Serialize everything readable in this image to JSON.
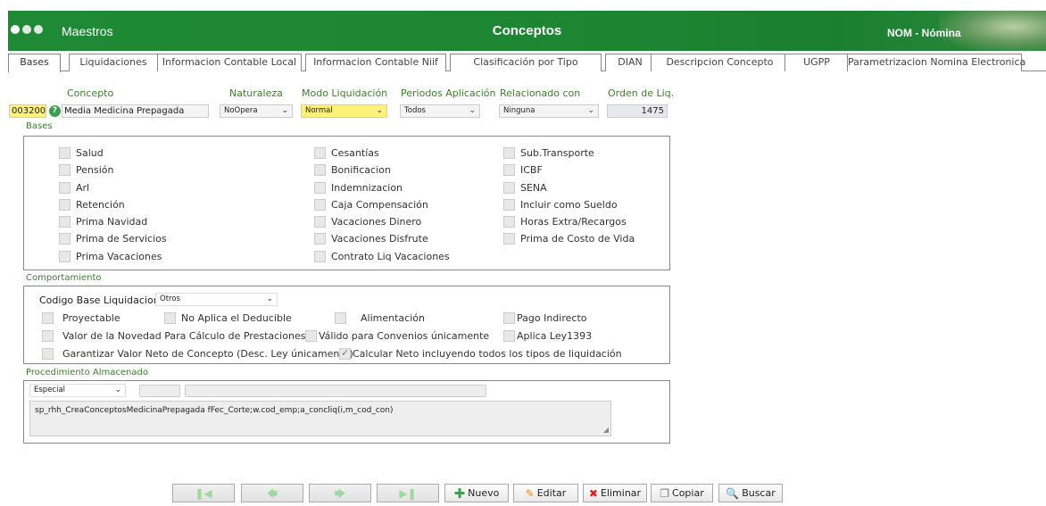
{
  "header": {
    "app_title": "Maestros",
    "page_title": "Conceptos",
    "module": "NOM - Nómina"
  },
  "tabs": [
    {
      "label": "Bases"
    },
    {
      "label": "Liquidaciones"
    },
    {
      "label": "Informacion Contable Local"
    },
    {
      "label": "Informacion Contable Niif"
    },
    {
      "label": "Clasificación por Tipo"
    },
    {
      "label": "DIAN"
    },
    {
      "label": "Descripcion Concepto"
    },
    {
      "label": "UGPP"
    },
    {
      "label": "Parametrizacion Nomina Electronica"
    }
  ],
  "form": {
    "concepto_label": "Concepto",
    "naturaleza_label": "Naturaleza",
    "modo_label": "Modo Liquidación",
    "periodos_label": "Periodos Aplicación",
    "relacionado_label": "Relacionado con",
    "orden_label": "Orden de Liq.",
    "concepto_code": "003200",
    "concepto_name": "Media Medicina Prepagada",
    "naturaleza_value": "NoOpera",
    "modo_value": "Normal",
    "periodos_value": "Todos",
    "relacionado_value": "Ninguna",
    "orden_value": "1475"
  },
  "bases": {
    "title": "Bases",
    "col1": [
      "Salud",
      "Pensión",
      "Arl",
      "Retención",
      "Prima Navidad",
      "Prima de Servicios",
      "Prima Vacaciones"
    ],
    "col2": [
      "Cesantías",
      "Bonificacion",
      "Indemnizacion",
      "Caja Compensación",
      "Vacaciones Dinero",
      "Vacaciones Disfrute",
      "Contrato Liq Vacaciones"
    ],
    "col3": [
      "Sub.Transporte",
      "ICBF",
      "SENA",
      "Incluir como Sueldo",
      "Horas Extra/Recargos",
      "Prima de Costo de Vida"
    ]
  },
  "comportamiento": {
    "title": "Comportamiento",
    "codigo_label": "Codigo Base Liquidacion",
    "codigo_value": "Otros",
    "proyectable": "Proyectable",
    "no_aplica": "No Aplica el Deducible",
    "alimentacion": "Alimentación",
    "pago_indirecto": "Pago Indirecto",
    "valor_novedad": "Valor de la Novedad Para Cálculo de Prestaciones",
    "valido_convenios": "Válido para Convenios únicamente",
    "aplica_ley": "Aplica Ley1393",
    "garantizar": "Garantizar Valor Neto de Concepto (Desc. Ley únicamente)",
    "calcular_neto": "Calcular Neto incluyendo todos los tipos de liquidación",
    "calcular_neto_checked": true
  },
  "procedimiento": {
    "title": "Procedimiento Almacenado",
    "tipo_value": "Especial",
    "text": "sp_rhh_CreaConceptosMedicinaPrepagada fFec_Corte;w.cod_emp;a_concliq(i,m_cod_con)"
  },
  "toolbar": {
    "nuevo": "Nuevo",
    "editar": "Editar",
    "eliminar": "Eliminar",
    "copiar": "Copiar",
    "buscar": "Buscar"
  }
}
